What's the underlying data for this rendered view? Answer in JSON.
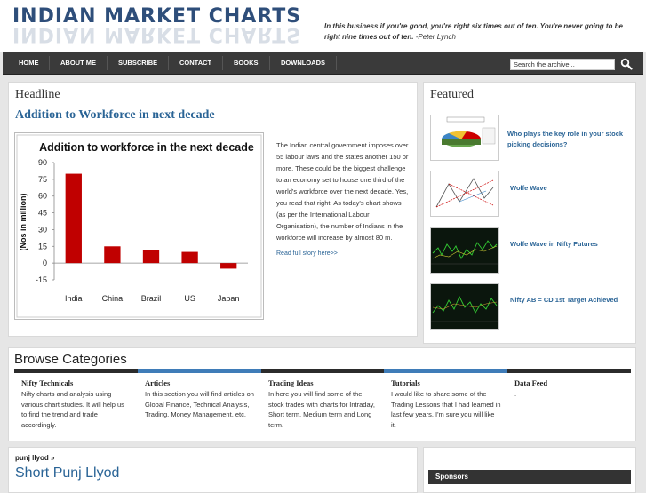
{
  "header": {
    "logo_text": "INDIAN MARKET CHARTS",
    "quote": "In this business if you're good, you're right six times out of ten. You're never going to be right nine times out of ten.",
    "quote_author": "-Peter Lynch"
  },
  "nav": {
    "items": [
      "HOME",
      "ABOUT ME",
      "SUBSCRIBE",
      "CONTACT",
      "BOOKS",
      "DOWNLOADS"
    ],
    "search_placeholder": "Search the archive..."
  },
  "headline": {
    "section_label": "Headline",
    "title": "Addition to Workforce in next decade",
    "body": "The Indian central government imposes over 55 labour laws and the states another 150 or more. These could be the biggest challenge to an economy set to house one third of the world's workforce over the next decade. Yes, you read that right! As today's chart shows (as per the International Labour Organisation), the number of Indians in the workforce will increase by almost 80 m.",
    "read_more": "Read full story here>>"
  },
  "chart_data": {
    "type": "bar",
    "title": "Addition to workforce in the next decade",
    "ylabel": "(Nos in million)",
    "xlabel": "",
    "categories": [
      "India",
      "China",
      "Brazil",
      "US",
      "Japan"
    ],
    "values": [
      80,
      15,
      12,
      10,
      -5
    ],
    "ylim": [
      -15,
      90
    ],
    "yticks": [
      90,
      75,
      60,
      45,
      30,
      15,
      0,
      -15
    ],
    "grid": false,
    "bar_color": "#c00000"
  },
  "featured": {
    "section_label": "Featured",
    "items": [
      {
        "label": "Who plays the key role in your stock picking decisions?",
        "thumb": "pie-chart-thumb"
      },
      {
        "label": "Wolfe Wave",
        "thumb": "wolfe-wave-thumb"
      },
      {
        "label": "Wolfe Wave in Nifty Futures",
        "thumb": "price-chart-thumb"
      },
      {
        "label": "Nifty AB = CD 1st Target Achieved",
        "thumb": "price-chart-thumb"
      }
    ]
  },
  "categories": {
    "section_label": "Browse Categories",
    "items": [
      {
        "title": "Nifty Technicals",
        "desc": "Nifty charts and analysis using various chart studies. It will help us to find the trend and trade accordingly."
      },
      {
        "title": "Articles",
        "desc": "In this section you will find articles on Global Finance, Technical Analysis, Trading, Money Management, etc."
      },
      {
        "title": "Trading Ideas",
        "desc": "In here you will find some of the stock trades with charts for Intraday, Short term, Medium term and Long term."
      },
      {
        "title": "Tutorials",
        "desc": "I would like to share some of the Trading Lessons that I had learned in last few years. I'm sure you will like it."
      },
      {
        "title": "Data Feed",
        "desc": "."
      }
    ]
  },
  "post": {
    "breadcrumb": "punj llyod »",
    "title": "Short Punj Llyod"
  },
  "sidebar": {
    "sponsors_label": "Sponsors"
  },
  "colors": {
    "logo": "#2e4e7a",
    "link": "#2a6496",
    "nav_bg": "#3a3a3a",
    "cat_dark": "#2b2b2b",
    "cat_blue": "#3f7cb8"
  }
}
